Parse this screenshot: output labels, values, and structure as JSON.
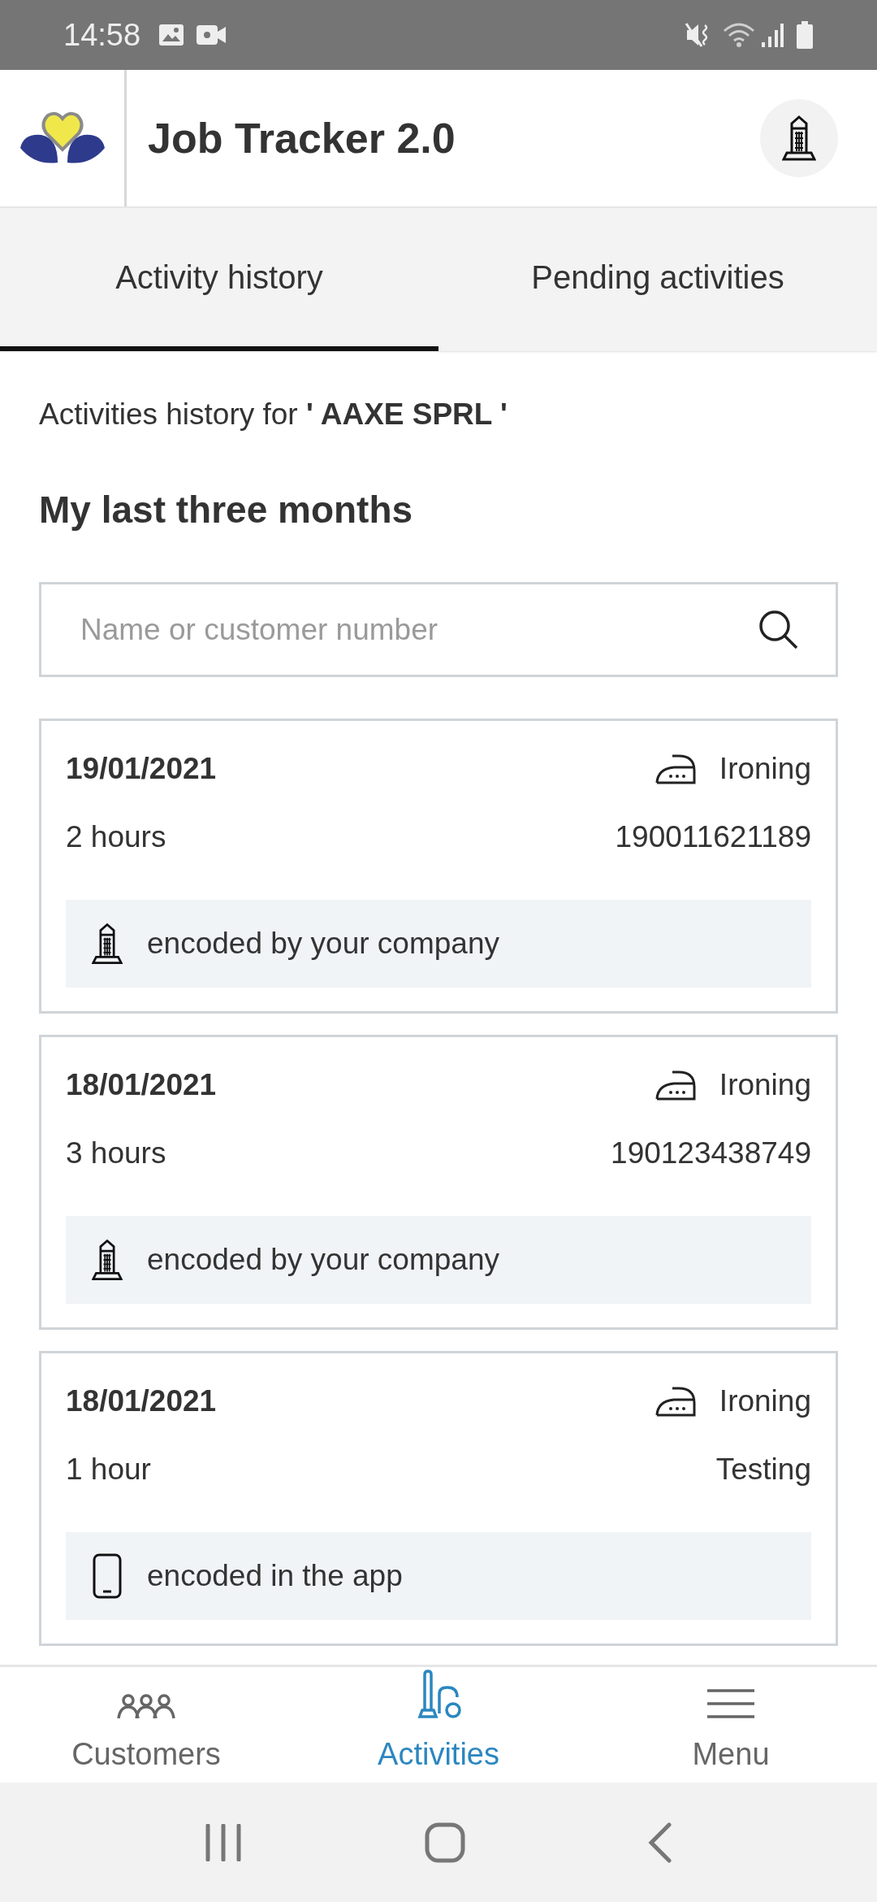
{
  "status_bar": {
    "time": "14:58"
  },
  "header": {
    "title": "Job Tracker 2.0"
  },
  "tabs": [
    {
      "label": "Activity history",
      "selected": true
    },
    {
      "label": "Pending activities",
      "selected": false
    }
  ],
  "subtitle": "Activities history for **' AAXE SPRL '**",
  "section_title": "My last three months",
  "search": {
    "placeholder": "Name or customer number"
  },
  "activities": [
    {
      "date": "19/01/2021",
      "service": {
        "kind": "ironing",
        "label": "Ironing"
      },
      "duration": "2 hours",
      "reference": "190011621189",
      "source": {
        "kind": "company",
        "text": "encoded by your company"
      }
    },
    {
      "date": "18/01/2021",
      "service": {
        "kind": "ironing",
        "label": "Ironing"
      },
      "duration": "3 hours",
      "reference": "190123438749",
      "source": {
        "kind": "company",
        "text": "encoded by your company"
      }
    },
    {
      "date": "18/01/2021",
      "service": {
        "kind": "ironing",
        "label": "Ironing"
      },
      "duration": "1 hour",
      "reference": "Testing",
      "source": {
        "kind": "app",
        "text": "encoded in the app"
      }
    }
  ],
  "bottom_nav": [
    {
      "label": "Customers",
      "kind": "customers",
      "selected": false
    },
    {
      "label": "Activities",
      "kind": "activities",
      "selected": true
    },
    {
      "label": "Menu",
      "kind": "menu",
      "selected": false
    }
  ]
}
